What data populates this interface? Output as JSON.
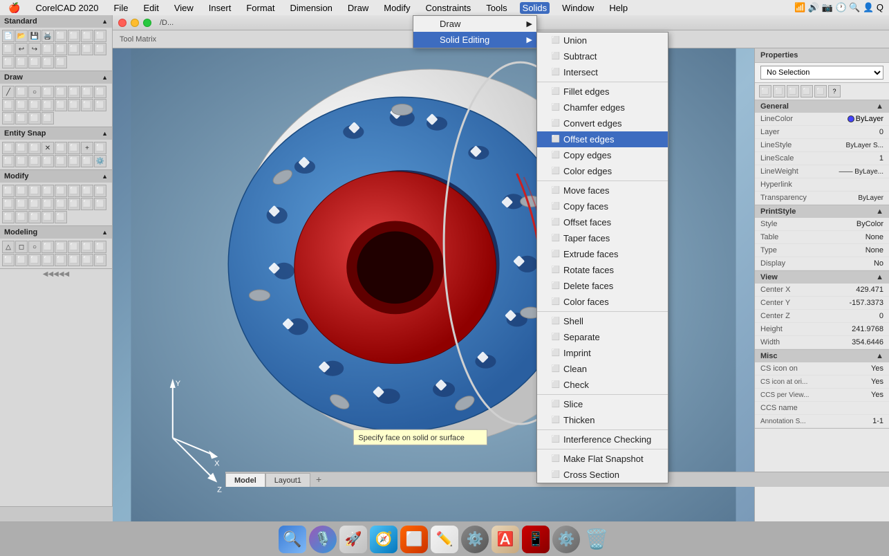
{
  "app": {
    "title": "CorelCAD 2020",
    "window_title": "/D...",
    "os": "macOS"
  },
  "menu_bar": {
    "apple": "🍎",
    "items": [
      {
        "label": "CorelCAD 2020",
        "active": false
      },
      {
        "label": "File",
        "active": false
      },
      {
        "label": "Edit",
        "active": false
      },
      {
        "label": "View",
        "active": false
      },
      {
        "label": "Insert",
        "active": false
      },
      {
        "label": "Format",
        "active": false
      },
      {
        "label": "Dimension",
        "active": false
      },
      {
        "label": "Draw",
        "active": false
      },
      {
        "label": "Modify",
        "active": false
      },
      {
        "label": "Constraints",
        "active": false
      },
      {
        "label": "Tools",
        "active": false
      },
      {
        "label": "Solids",
        "active": true
      },
      {
        "label": "Window",
        "active": false
      },
      {
        "label": "Help",
        "active": false
      }
    ]
  },
  "solids_menu": {
    "items": [
      {
        "label": "Draw",
        "has_submenu": true
      },
      {
        "label": "Solid Editing",
        "has_submenu": true,
        "highlighted": true
      }
    ],
    "solid_editing_submenu": [
      {
        "label": "Union",
        "icon": "box"
      },
      {
        "label": "Subtract",
        "icon": "box"
      },
      {
        "label": "Intersect",
        "icon": "box"
      },
      {
        "separator": true
      },
      {
        "label": "Fillet edges",
        "icon": "box"
      },
      {
        "label": "Chamfer edges",
        "icon": "box"
      },
      {
        "label": "Convert edges",
        "icon": "box"
      },
      {
        "label": "Offset edges",
        "icon": "box",
        "highlighted": true
      },
      {
        "label": "Copy edges",
        "icon": "box"
      },
      {
        "label": "Color edges",
        "icon": "box"
      },
      {
        "separator": true
      },
      {
        "label": "Move faces",
        "icon": "box"
      },
      {
        "label": "Copy faces",
        "icon": "box"
      },
      {
        "label": "Offset faces",
        "icon": "box"
      },
      {
        "label": "Taper faces",
        "icon": "box"
      },
      {
        "label": "Extrude faces",
        "icon": "box"
      },
      {
        "label": "Rotate faces",
        "icon": "box"
      },
      {
        "label": "Delete faces",
        "icon": "box"
      },
      {
        "label": "Color faces",
        "icon": "box"
      },
      {
        "separator": true
      },
      {
        "label": "Shell",
        "icon": "box"
      },
      {
        "label": "Separate",
        "icon": "box"
      },
      {
        "label": "Imprint",
        "icon": "box"
      },
      {
        "label": "Clean",
        "icon": "box"
      },
      {
        "label": "Check",
        "icon": "box"
      },
      {
        "separator": true
      },
      {
        "label": "Slice",
        "icon": "box"
      },
      {
        "label": "Thicken",
        "icon": "box"
      },
      {
        "separator": true
      },
      {
        "label": "Interference Checking",
        "icon": "box"
      },
      {
        "separator": true
      },
      {
        "label": "Make Flat Snapshot",
        "icon": "box"
      },
      {
        "label": "Cross Section",
        "icon": "box"
      }
    ]
  },
  "left_sidebar": {
    "sections": [
      {
        "label": "Standard",
        "collapsed": false
      },
      {
        "label": "Draw",
        "collapsed": false
      },
      {
        "label": "Entity Snap",
        "collapsed": false
      },
      {
        "label": "Modify",
        "collapsed": false
      },
      {
        "label": "Modeling",
        "collapsed": false
      }
    ]
  },
  "properties_panel": {
    "title": "Properties",
    "no_selection": "No Selection",
    "sections": {
      "general": {
        "label": "General",
        "rows": [
          {
            "label": "LineColor",
            "value": "ByLayer",
            "has_dot": true
          },
          {
            "label": "Layer",
            "value": "0"
          },
          {
            "label": "LineStyle",
            "value": "ByLayer  S..."
          },
          {
            "label": "LineScale",
            "value": "1"
          },
          {
            "label": "LineWeight",
            "value": "—— ByLaye..."
          },
          {
            "label": "Hyperlink",
            "value": ""
          },
          {
            "label": "Transparency",
            "value": "ByLayer"
          }
        ]
      },
      "print_style": {
        "label": "PrintStyle",
        "rows": [
          {
            "label": "Style",
            "value": "ByColor"
          },
          {
            "label": "Table",
            "value": "None"
          },
          {
            "label": "Type",
            "value": "None"
          },
          {
            "label": "Display",
            "value": "No"
          }
        ]
      },
      "view": {
        "label": "View",
        "rows": [
          {
            "label": "Center X",
            "value": "429.471"
          },
          {
            "label": "Center Y",
            "value": "-157.3373"
          },
          {
            "label": "Center Z",
            "value": "0"
          },
          {
            "label": "Height",
            "value": "241.9768"
          },
          {
            "label": "Width",
            "value": "354.6446"
          }
        ]
      },
      "misc": {
        "label": "Misc",
        "rows": [
          {
            "label": "CS icon on",
            "value": "Yes"
          },
          {
            "label": "CS icon at ori...",
            "value": "Yes"
          },
          {
            "label": "CCS per View...",
            "value": "Yes"
          },
          {
            "label": "CCS name",
            "value": ""
          },
          {
            "label": "Annotation S...",
            "value": "1-1"
          }
        ]
      }
    }
  },
  "tabs": [
    {
      "label": "Model",
      "active": true
    },
    {
      "label": "Layout1",
      "active": false
    }
  ],
  "viewport": {
    "tooltip": "Specify face on solid or surface"
  },
  "dock": {
    "icons": [
      "🔍",
      "🎙️",
      "🚀",
      "🧭",
      "⬜",
      "✏️",
      "⚙️",
      "🅰️",
      "📱",
      "⚙️",
      "🗑️"
    ]
  }
}
